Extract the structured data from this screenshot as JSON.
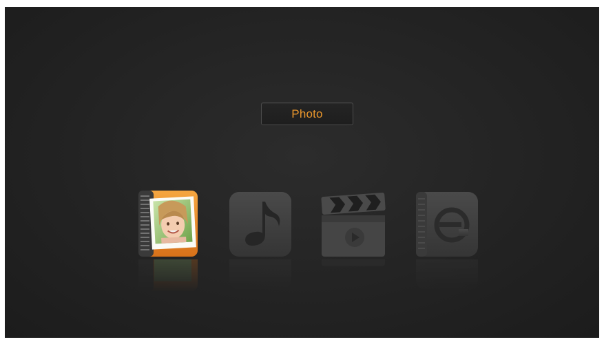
{
  "menu": {
    "selected_label": "Photo",
    "accent_color": "#e9962c",
    "items": [
      {
        "id": "photo",
        "icon": "photo-album-icon",
        "selected": true
      },
      {
        "id": "music",
        "icon": "music-note-icon",
        "selected": false
      },
      {
        "id": "movie",
        "icon": "clapperboard-icon",
        "selected": false
      },
      {
        "id": "ebook",
        "icon": "ebook-icon",
        "selected": false
      }
    ]
  }
}
